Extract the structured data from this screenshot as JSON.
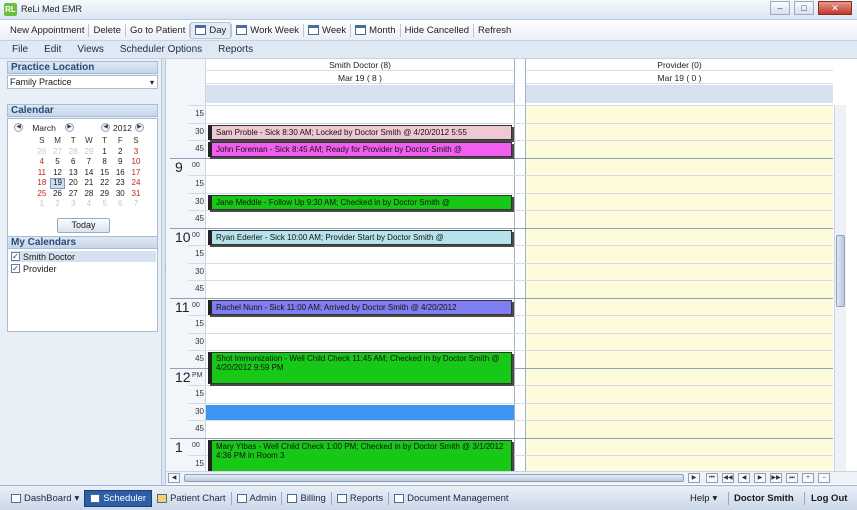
{
  "window": {
    "title": "ReLi Med EMR",
    "logo_text": "RL",
    "minimize": "–",
    "maximize": "□",
    "close": "✕"
  },
  "toolbar": {
    "new_appointment": "New Appointment",
    "delete": "Delete",
    "go_to_patient": "Go to Patient",
    "day": "Day",
    "work_week": "Work Week",
    "week": "Week",
    "month": "Month",
    "hide_cancelled": "Hide Cancelled",
    "refresh": "Refresh"
  },
  "menu": {
    "file": "File",
    "edit": "Edit",
    "views": "Views",
    "scheduler_options": "Scheduler Options",
    "reports": "Reports"
  },
  "sidebar": {
    "practice_location_header": "Practice Location",
    "practice_location_value": "Family Practice",
    "calendar_header": "Calendar",
    "month": "March",
    "year": "2012",
    "weekday_headers": [
      "S",
      "M",
      "T",
      "W",
      "T",
      "F",
      "S"
    ],
    "weeks": [
      [
        "26",
        "27",
        "28",
        "29",
        "1",
        "2",
        "3"
      ],
      [
        "4",
        "5",
        "6",
        "7",
        "8",
        "9",
        "10"
      ],
      [
        "11",
        "12",
        "13",
        "14",
        "15",
        "16",
        "17"
      ],
      [
        "18",
        "19",
        "20",
        "21",
        "22",
        "23",
        "24"
      ],
      [
        "25",
        "26",
        "27",
        "28",
        "29",
        "30",
        "31"
      ],
      [
        "1",
        "2",
        "3",
        "4",
        "5",
        "6",
        "7"
      ]
    ],
    "today_button": "Today",
    "my_calendars_header": "My Calendars",
    "calendars": [
      {
        "name": "Smith Doctor",
        "checked": true
      },
      {
        "name": "Provider",
        "checked": true
      }
    ]
  },
  "scheduler": {
    "columns": [
      {
        "resource": "Smith Doctor (8)",
        "date": "Mar 19 ( 8 )"
      },
      {
        "resource": "Provider (0)",
        "date": "Mar 19 ( 0 )"
      }
    ],
    "slots": [
      {
        "minute": "15"
      },
      {
        "minute": "30"
      },
      {
        "minute": "45"
      },
      {
        "hour": "9",
        "suffix": "00"
      },
      {
        "minute": "15"
      },
      {
        "minute": "30"
      },
      {
        "minute": "45"
      },
      {
        "hour": "10",
        "suffix": "00"
      },
      {
        "minute": "15"
      },
      {
        "minute": "30"
      },
      {
        "minute": "45"
      },
      {
        "hour": "11",
        "suffix": "00"
      },
      {
        "minute": "15"
      },
      {
        "minute": "30"
      },
      {
        "minute": "45"
      },
      {
        "hour": "12",
        "suffix": "PM"
      },
      {
        "minute": "15"
      },
      {
        "minute": "30"
      },
      {
        "minute": "45"
      },
      {
        "hour": "1",
        "suffix": "00"
      },
      {
        "minute": "15"
      }
    ],
    "appointments": [
      {
        "text": "Sam  Proble - Sick 8:30 AM; Locked by Doctor Smith @ 4/20/2012 5:55",
        "color": "#efc9d2"
      },
      {
        "text": "John  Foreman - Sick 8:45 AM; Ready for Provider by Doctor Smith @",
        "color": "#f25ff0"
      },
      {
        "text": "Jane  Meddle - Follow Up 9:30 AM; Checked in by Doctor Smith @",
        "color": "#17c817"
      },
      {
        "text": "Ryan  Ederler - Sick 10:00 AM; Provider Start by Doctor Smith @",
        "color": "#b5e3ec"
      },
      {
        "text": "Rachel  Nunn - Sick 11:00 AM; Arrived by Doctor Smith @ 4/20/2012",
        "color": "#7f7ff2"
      },
      {
        "text": "Shot  Immunization - Well Child Check 11:45 AM; Checked in by Doctor Smith @ 4/20/2012 9:59 PM",
        "color": "#17c817"
      },
      {
        "text": "",
        "color": "#3c95f2"
      },
      {
        "text": "Mary  Ytbas - Well Child Check 1:00 PM; Checked in by Doctor Smith @ 3/1/2012 4:36 PM in Room 3",
        "color": "#17c817"
      }
    ]
  },
  "bottom_nav": {
    "dashboard": "DashBoard",
    "scheduler": "Scheduler",
    "patient_chart": "Patient Chart",
    "admin": "Admin",
    "billing": "Billing",
    "reports": "Reports",
    "document_management": "Document Management",
    "help": "Help",
    "user": "Doctor Smith",
    "logout": "Log Out"
  }
}
